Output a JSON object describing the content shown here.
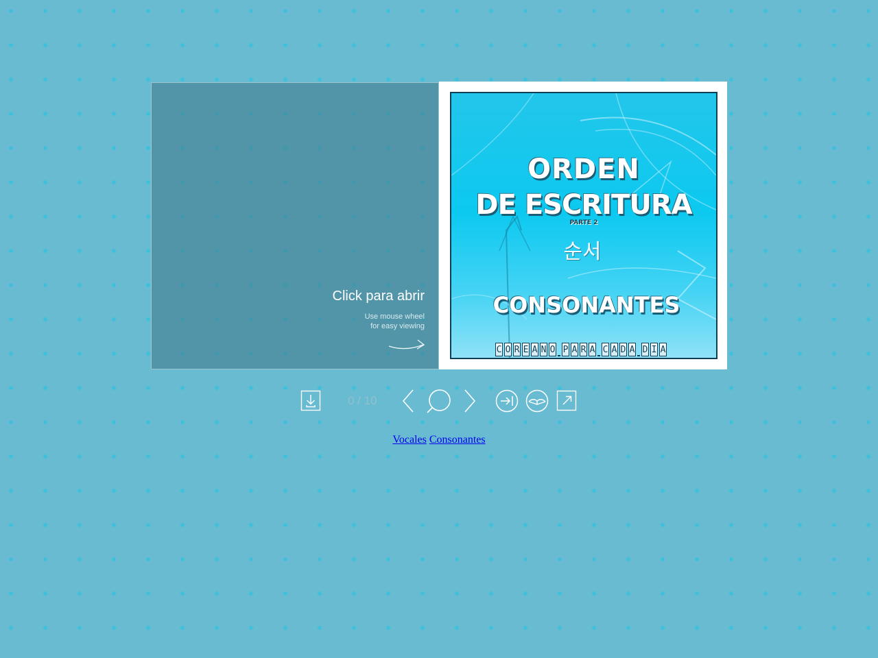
{
  "flipbook": {
    "open_label": "Click para abrir",
    "hint_line1": "Use mouse wheel",
    "hint_line2": "for easy viewing",
    "cover": {
      "title_line1": "ORDEN",
      "title_line2": "DE ESCRITURA",
      "subtitle": "PARTE 2",
      "korean": "순서",
      "section": "CONSONANTES",
      "brand": "COREANO PARA CADA DIA"
    }
  },
  "toolbar": {
    "page_counter": "0 / 10",
    "icons": {
      "download": "download-icon",
      "previous": "chevron-left-icon",
      "zoom": "magnifier-icon",
      "next": "chevron-right-icon",
      "last": "last-page-icon",
      "table_of_contents": "open-book-icon",
      "fullscreen": "fullscreen-icon"
    }
  },
  "links": [
    {
      "label": "Vocales"
    },
    {
      "label": "Consonantes"
    }
  ],
  "colors": {
    "background": "#68bbd1",
    "dots": "#3fc1dc",
    "left_page": "#54929f",
    "cover_blue": "#0cc9f0",
    "cover_border": "#0e3f56",
    "link": "#0000ee"
  }
}
